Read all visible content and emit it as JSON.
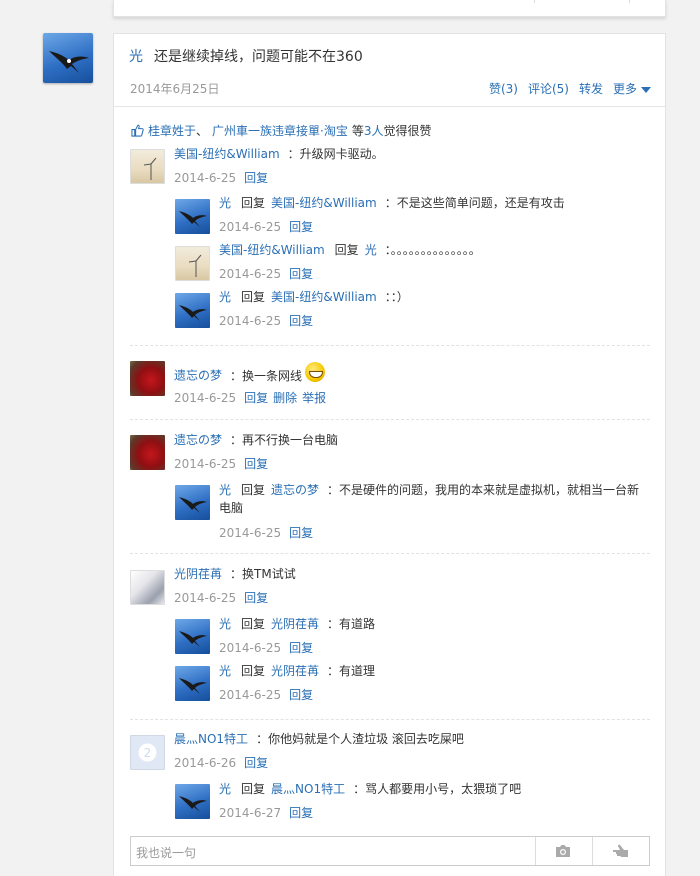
{
  "post": {
    "author": "光",
    "text": "还是继续掉线，问题可能不在360",
    "date": "2014年6月25日",
    "actions": {
      "like": "赞(3)",
      "comment": "评论(5)",
      "forward": "转发",
      "more": "更多"
    },
    "likes": {
      "user1": "桂章姓于",
      "separator": "、",
      "user2": "广州車一族违章接單·淘宝",
      "middle": "等",
      "count": "3人",
      "suffix": "觉得很赞"
    }
  },
  "comments": [
    {
      "user": "美国-纽约&William",
      "text": "：升级网卡驱动。",
      "date": "2014-6-25",
      "reply": "回复",
      "replies": [
        {
          "user": "光",
          "reply_word": "回复",
          "target": "美国-纽约&William",
          "text": "：不是这些简单问题，还是有攻击",
          "date": "2014-6-25",
          "reply": "回复"
        },
        {
          "user": "美国-纽约&William",
          "reply_word": "回复",
          "target": "光",
          "text": "：。。。。。。。。。。。。。。",
          "date": "2014-6-25",
          "reply": "回复"
        },
        {
          "user": "光",
          "reply_word": "回复",
          "target": "美国-纽约&William",
          "text": "：：）",
          "date": "2014-6-25",
          "reply": "回复"
        }
      ]
    },
    {
      "user": "遗忘の梦",
      "text": "：换一条网线",
      "date": "2014-6-25",
      "reply": "回复",
      "delete": "删除",
      "report": "举报"
    },
    {
      "user": "遗忘の梦",
      "text": "：再不行换一台电脑",
      "date": "2014-6-25",
      "reply": "回复",
      "replies": [
        {
          "user": "光",
          "reply_word": "回复",
          "target": "遗忘の梦",
          "text": "：不是硬件的问题，我用的本来就是虚拟机，就相当一台新",
          "text2": "电脑",
          "date": "2014-6-25",
          "reply": "回复"
        }
      ]
    },
    {
      "user": "光阴荏苒",
      "text": "：换TM试试",
      "date": "2014-6-25",
      "reply": "回复",
      "replies": [
        {
          "user": "光",
          "reply_word": "回复",
          "target": "光阴荏苒",
          "text": "：有道路",
          "date": "2014-6-25",
          "reply": "回复"
        },
        {
          "user": "光",
          "reply_word": "回复",
          "target": "光阴荏苒",
          "text": "：有道理",
          "date": "2014-6-25",
          "reply": "回复"
        }
      ]
    },
    {
      "user": "晨灬NO1特工",
      "text": "：你他妈就是个人渣垃圾 滚回去吃屎吧",
      "date": "2014-6-26",
      "reply": "回复",
      "replies": [
        {
          "user": "光",
          "reply_word": "回复",
          "target": "晨灬NO1特工",
          "text": "：骂人都要用小号，太猥琐了吧",
          "date": "2014-6-27",
          "reply": "回复"
        }
      ]
    }
  ],
  "input": {
    "placeholder": "我也说一句"
  },
  "icons": {
    "thumb": "thumbs-up-icon",
    "camera": "camera-icon",
    "hand": "pointing-hand-icon",
    "more_caret": "chevron-down-icon",
    "emoji": "grin-emoji-icon"
  },
  "colors": {
    "link": "#2a6fb5",
    "meta": "#999999",
    "text": "#333333"
  }
}
